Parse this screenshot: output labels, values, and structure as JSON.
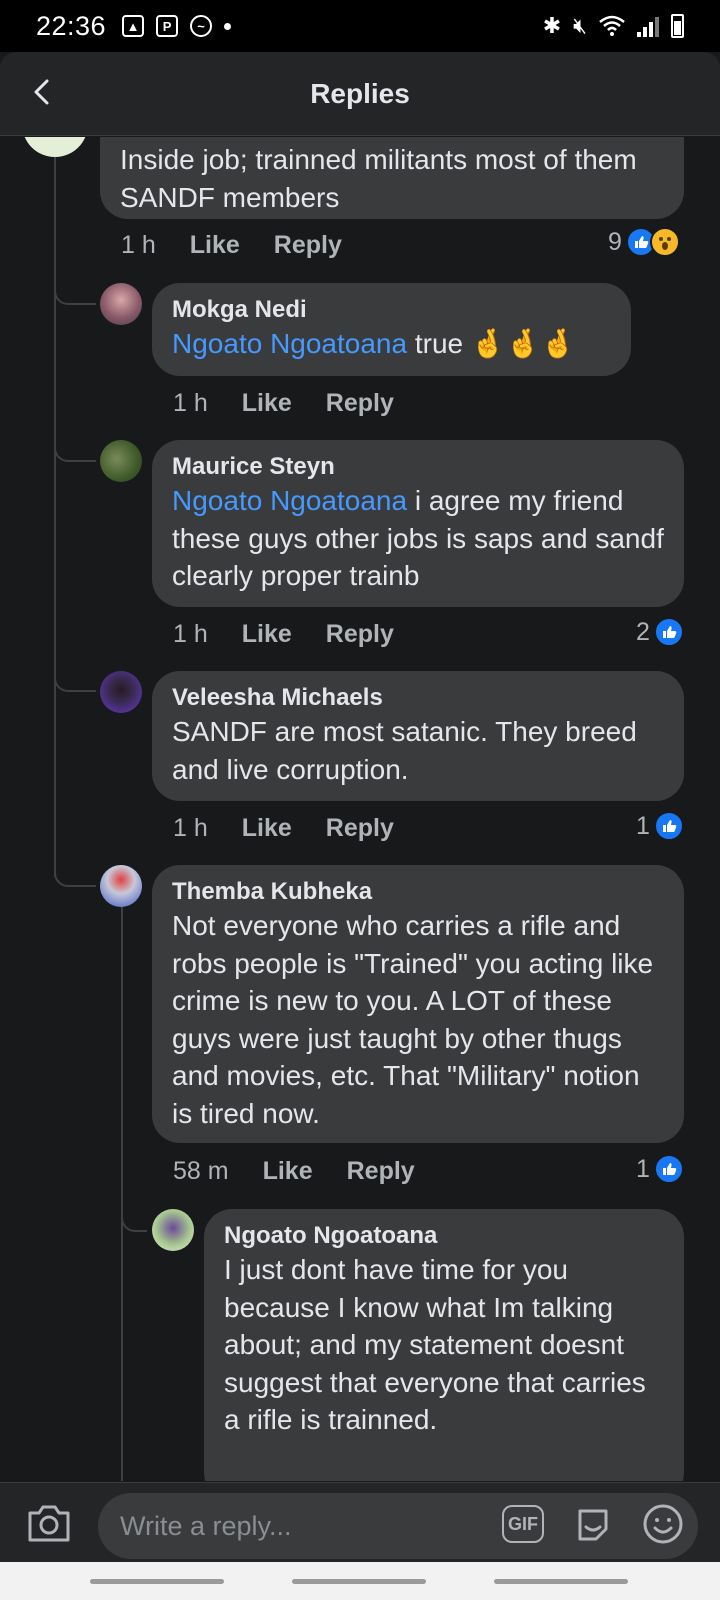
{
  "status_bar": {
    "time": "22:36",
    "left_icons": [
      "image-icon",
      "parking-icon",
      "messenger-icon",
      "dot-icon"
    ],
    "right_icons": [
      "bluetooth-icon",
      "mute-icon",
      "wifi-icon",
      "signal-icon",
      "battery-icon"
    ]
  },
  "header": {
    "title": "Replies",
    "back_icon": "chevron-left-icon"
  },
  "comments": [
    {
      "text": "Inside job; trainned militants most of them SANDF members",
      "time": "1 h",
      "like": "Like",
      "reply": "Reply",
      "reaction_count": "9",
      "reactions": [
        "like",
        "wow"
      ]
    },
    {
      "author": "Mokga Nedi",
      "mention": "Ngoato Ngoatoana",
      "text": " true ",
      "emoji": "🤞🤞🤞",
      "time": "1 h",
      "like": "Like",
      "reply": "Reply"
    },
    {
      "author": "Maurice Steyn",
      "mention": "Ngoato Ngoatoana",
      "text": "  i agree my friend these guys other jobs is saps and sandf clearly proper trainb",
      "time": "1 h",
      "like": "Like",
      "reply": "Reply",
      "reaction_count": "2",
      "reactions": [
        "like"
      ]
    },
    {
      "author": "Veleesha Michaels",
      "text": "SANDF are most satanic. They breed and live corruption.",
      "time": "1 h",
      "like": "Like",
      "reply": "Reply",
      "reaction_count": "1",
      "reactions": [
        "like"
      ]
    },
    {
      "author": "Themba Kubheka",
      "text": "Not everyone who carries a rifle and robs people is \"Trained\" you acting like crime is new to you. A LOT of these guys were just taught by other thugs and movies,  etc. That \"Military\" notion is tired now.",
      "time": "58 m",
      "like": "Like",
      "reply": "Reply",
      "reaction_count": "1",
      "reactions": [
        "like"
      ]
    },
    {
      "author": "Ngoato Ngoatoana",
      "text": "I just dont have time for you because I know what Im talking about; and my statement doesnt suggest that everyone that carries a rifle is trainned."
    }
  ],
  "composer": {
    "placeholder": "Write a reply...",
    "gif_label": "GIF",
    "icons": [
      "camera-icon",
      "gif-icon",
      "sticker-icon",
      "emoji-icon"
    ]
  },
  "colors": {
    "background": "#18191a",
    "bubble": "#3a3b3c",
    "mention": "#4599ff",
    "like_blue": "#1877f2",
    "wow_yellow": "#f7b928"
  }
}
